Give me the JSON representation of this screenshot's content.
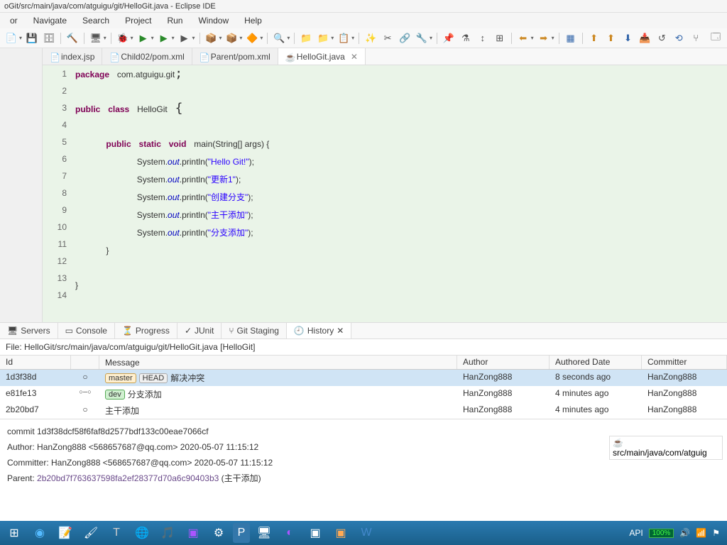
{
  "window": {
    "title": "oGit/src/main/java/com/atguigu/git/HelloGit.java - Eclipse IDE"
  },
  "menu": {
    "items": [
      "or",
      "Navigate",
      "Search",
      "Project",
      "Run",
      "Window",
      "Help"
    ]
  },
  "editor_tabs": [
    {
      "label": "index.jsp",
      "active": false
    },
    {
      "label": "Child02/pom.xml",
      "active": false
    },
    {
      "label": "Parent/pom.xml",
      "active": false
    },
    {
      "label": "HelloGit.java",
      "active": true
    }
  ],
  "code": {
    "lines_gutter": [
      "1",
      "2",
      "3",
      "4",
      "5",
      "6",
      "7",
      "8",
      "9",
      "10",
      "11",
      "12",
      "13",
      "14"
    ],
    "pkg": "package",
    "pkg_path": "com.atguigu.git",
    "public": "public",
    "class": "class",
    "classname": "HelloGit",
    "static": "static",
    "void": "void",
    "main": "main",
    "args": "(String[] args) {",
    "sys": "System.",
    "out": "out",
    "println": ".println(",
    "s1": "\"Hello Git!\"",
    "s2": "\"更新1\"",
    "s3": "\"创建分支\"",
    "s4": "\"主干添加\"",
    "s5": "\"分支添加\"",
    "semi": ");",
    "rbrace": "}"
  },
  "bottom_tabs": [
    "Servers",
    "Console",
    "Progress",
    "JUnit",
    "Git Staging",
    "History"
  ],
  "file_info": "File: HelloGit/src/main/java/com/atguigu/git/HelloGit.java [HelloGit]",
  "history": {
    "cols": {
      "id": "Id",
      "msg": "Message",
      "auth": "Author",
      "date": "Authored Date",
      "comm": "Committer"
    },
    "rows": [
      {
        "id": "1d3f38d",
        "graph": "○",
        "tags": [
          {
            "t": "master",
            "c": "m"
          },
          {
            "t": "HEAD",
            "c": "h"
          }
        ],
        "msg": "解决冲突",
        "auth": "HanZong888",
        "date": "8 seconds ago",
        "comm": "HanZong888"
      },
      {
        "id": "e81fe13",
        "graph": "○─○",
        "tags": [
          {
            "t": "dev",
            "c": "d"
          }
        ],
        "msg": "分支添加",
        "auth": "HanZong888",
        "date": "4 minutes ago",
        "comm": "HanZong888"
      },
      {
        "id": "2b20bd7",
        "graph": "○",
        "tags": [],
        "msg": "主干添加",
        "auth": "HanZong888",
        "date": "4 minutes ago",
        "comm": "HanZong888"
      }
    ]
  },
  "commit": {
    "l1": "commit 1d3f38dcf58f6faf8d2577bdf133c00eae7066cf",
    "l2": "Author: HanZong888 <568657687@qq.com> 2020-05-07 11:15:12",
    "l3": "Committer: HanZong888 <568657687@qq.com> 2020-05-07 11:15:12",
    "l4a": "Parent: ",
    "l4b": "2b20bd7f763637598fa2ef28377d70a6c90403b3",
    "l4c": " (主干添加)"
  },
  "side_file": "src/main/java/com/atguig",
  "tray": {
    "api": "API",
    "batt": "100%"
  }
}
